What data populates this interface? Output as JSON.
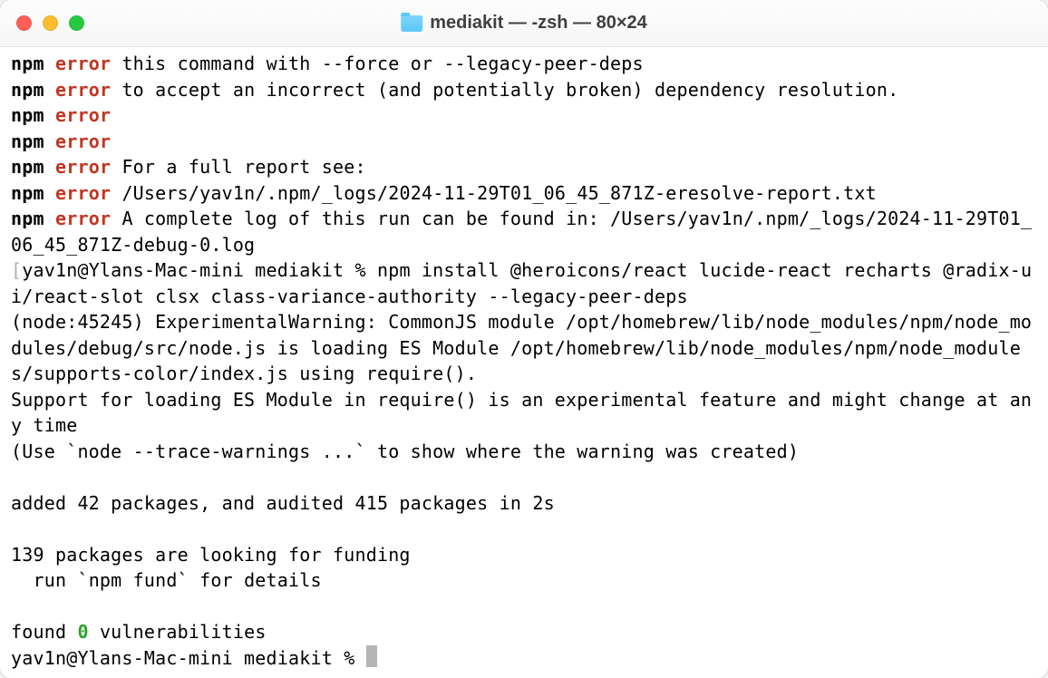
{
  "window": {
    "title": "mediakit — -zsh — 80×24"
  },
  "terminal": {
    "lines": [
      {
        "type": "npm_error",
        "text": "this command with --force or --legacy-peer-deps"
      },
      {
        "type": "npm_error",
        "text": "to accept an incorrect (and potentially broken) dependency resolution."
      },
      {
        "type": "npm_error",
        "text": ""
      },
      {
        "type": "npm_error",
        "text": ""
      },
      {
        "type": "npm_error",
        "text": "For a full report see:"
      },
      {
        "type": "npm_error",
        "text": "/Users/yav1n/.npm/_logs/2024-11-29T01_06_45_871Z-eresolve-report.txt"
      },
      {
        "type": "npm_error",
        "text": "A complete log of this run can be found in: /Users/yav1n/.npm/_logs/2024-11-29T01_06_45_871Z-debug-0.log"
      },
      {
        "type": "prompt_cmd",
        "prompt_left": "[",
        "user_host": "yav1n@Ylans-Mac-mini mediakit % ",
        "command": "npm install @heroicons/react lucide-react recharts @radix-ui/react-slot clsx class-variance-authority --legacy-peer-deps",
        "prompt_right": "]"
      },
      {
        "type": "plain",
        "text": "(node:45245) ExperimentalWarning: CommonJS module /opt/homebrew/lib/node_modules/npm/node_modules/debug/src/node.js is loading ES Module /opt/homebrew/lib/node_modules/npm/node_modules/supports-color/index.js using require()."
      },
      {
        "type": "plain",
        "text": "Support for loading ES Module in require() is an experimental feature and might change at any time"
      },
      {
        "type": "plain",
        "text": "(Use `node --trace-warnings ...` to show where the warning was created)"
      },
      {
        "type": "plain",
        "text": ""
      },
      {
        "type": "plain",
        "text": "added 42 packages, and audited 415 packages in 2s"
      },
      {
        "type": "plain",
        "text": ""
      },
      {
        "type": "plain",
        "text": "139 packages are looking for funding"
      },
      {
        "type": "plain",
        "text": "  run `npm fund` for details"
      },
      {
        "type": "plain",
        "text": ""
      },
      {
        "type": "vuln",
        "prefix": "found ",
        "count": "0",
        "suffix": " vulnerabilities"
      },
      {
        "type": "prompt_cursor",
        "user_host": "yav1n@Ylans-Mac-mini mediakit % "
      }
    ],
    "npm_label": "npm",
    "error_label": "error"
  }
}
